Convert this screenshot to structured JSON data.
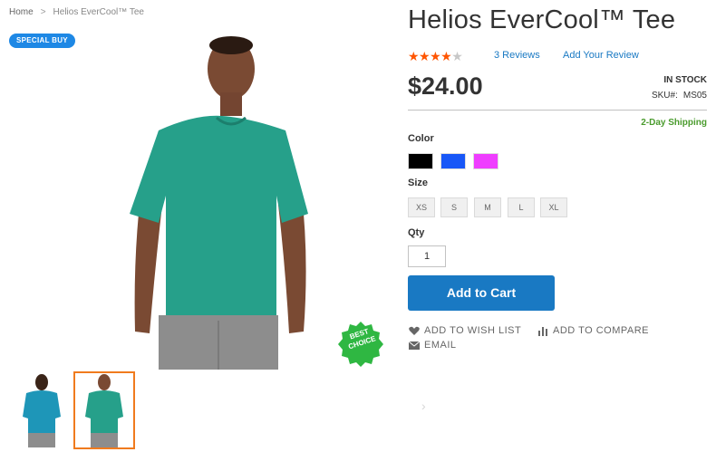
{
  "breadcrumb": {
    "home": "Home",
    "separator": ">",
    "current": "Helios EverCool™ Tee"
  },
  "badge": {
    "special_buy": "SPECIAL BUY"
  },
  "sticker": {
    "line1": "BEST",
    "line2": "CHOICE",
    "color": "#2fb742"
  },
  "product": {
    "title": "Helios EverCool™ Tee",
    "rating": {
      "stars_filled": 4,
      "stars_total": 5
    },
    "reviews_link": "3 Reviews",
    "add_review_link": "Add Your Review",
    "price": "$24.00",
    "stock": "IN STOCK",
    "sku_label": "SKU#:",
    "sku_value": "MS05",
    "shipping": "2-Day Shipping"
  },
  "options": {
    "color_label": "Color",
    "colors": [
      {
        "name": "black",
        "hex": "#000000"
      },
      {
        "name": "blue",
        "hex": "#1857f7"
      },
      {
        "name": "purple",
        "hex": "#ef3dff"
      }
    ],
    "size_label": "Size",
    "sizes": [
      "XS",
      "S",
      "M",
      "L",
      "XL"
    ],
    "qty_label": "Qty",
    "qty_value": "1"
  },
  "actions": {
    "add_to_cart": "Add to Cart",
    "wish_list": "ADD TO WISH LIST",
    "compare": "ADD TO COMPARE",
    "email": "EMAIL"
  },
  "colors": {
    "accent": "#1979c3",
    "star": "#ff5501",
    "shipping": "#4a9b2d",
    "thumb_selected": "#f07b1e"
  },
  "icons": {
    "wish": "heart-icon",
    "compare": "bar-chart-icon",
    "email": "envelope-icon",
    "next": "chevron-right-icon"
  }
}
